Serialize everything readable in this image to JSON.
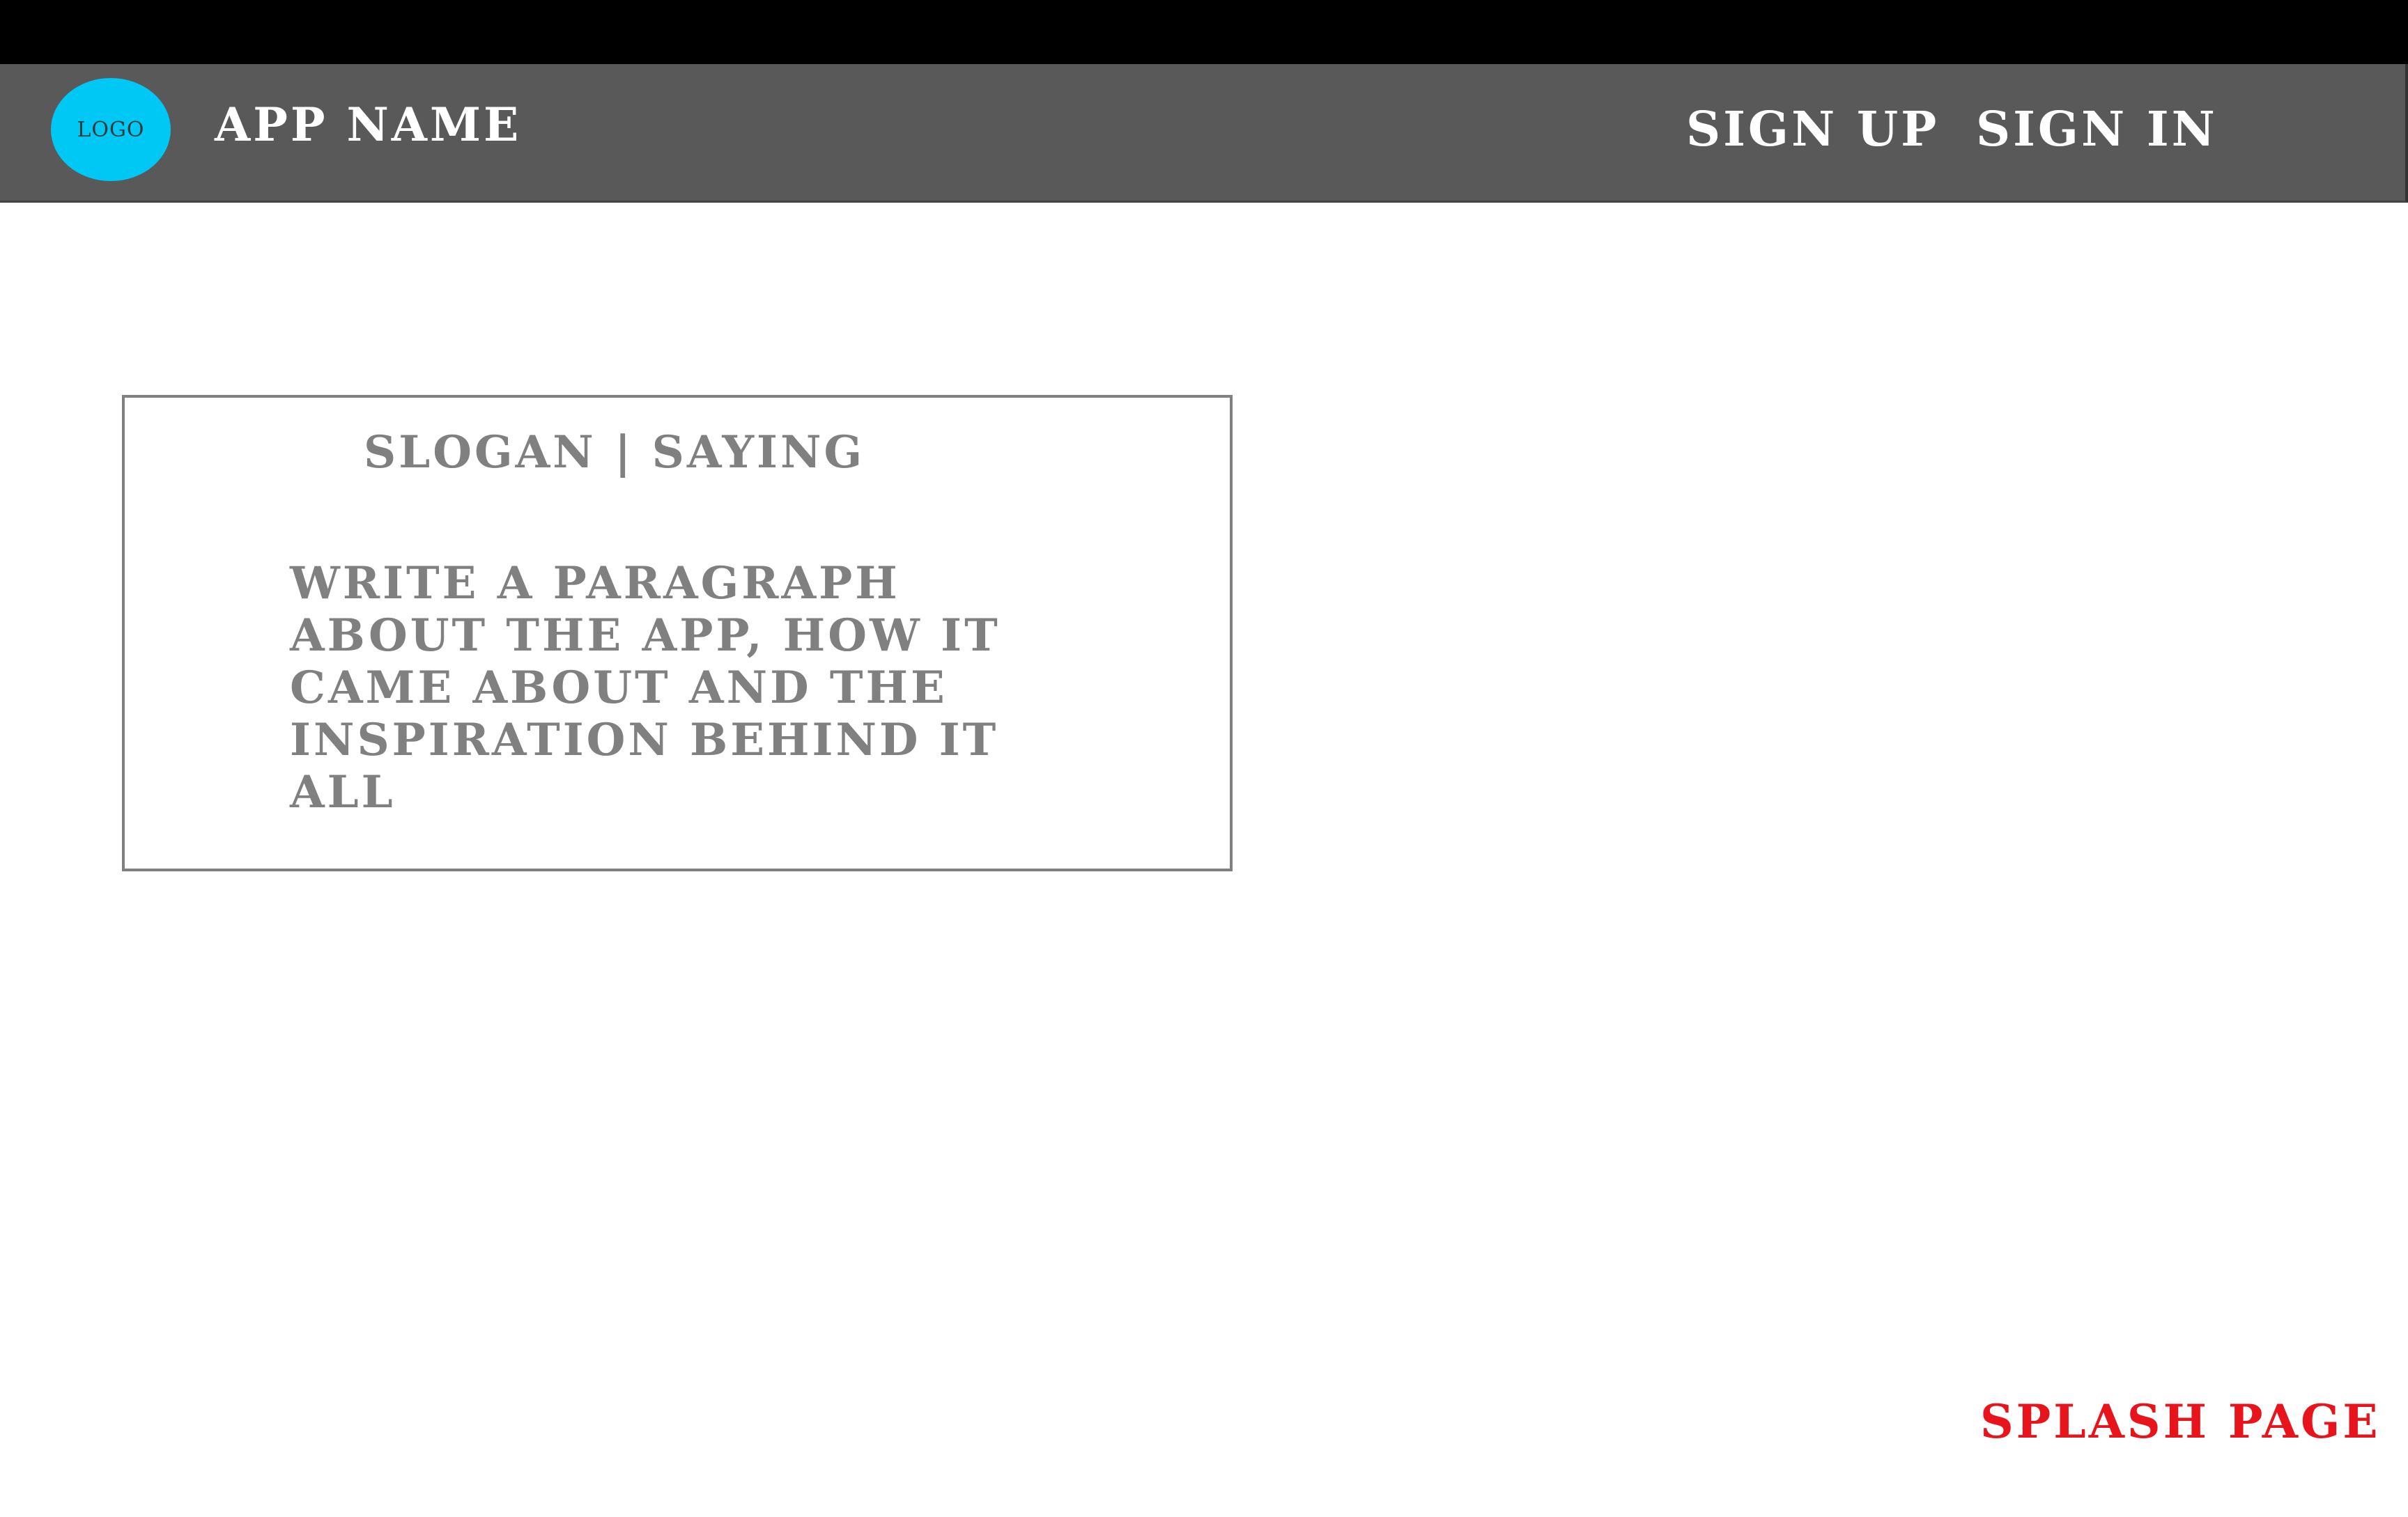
{
  "header": {
    "logo_label": "LOGO",
    "app_name": "APP NAME",
    "links": {
      "sign_up": "SIGN UP",
      "sign_in": "SIGN IN"
    }
  },
  "main": {
    "slogan": "SLOGAN | SAYING",
    "paragraph": "WRITE A PARAGRAPH ABOUT THE APP, HOW IT CAME ABOUT AND THE INSPIRATION BEHIND IT ALL"
  },
  "footer": {
    "page_label": "SPLASH PAGE"
  },
  "colors": {
    "top_bar": "#000000",
    "nav_bar": "#595959",
    "logo": "#00c8f5",
    "text_muted": "#808080",
    "page_label": "#e8141c"
  }
}
